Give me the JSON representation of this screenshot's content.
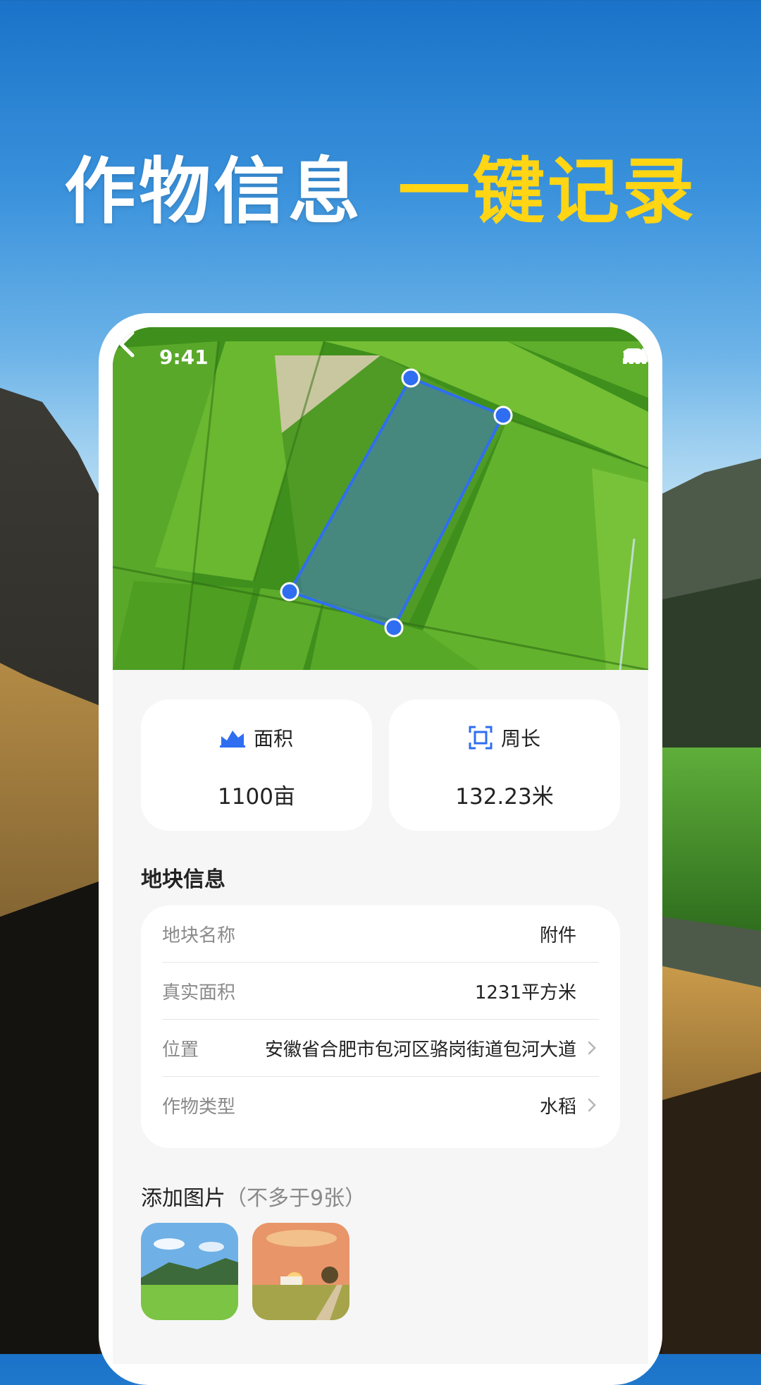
{
  "headline": {
    "part1": "作物信息",
    "part2": "一键记录"
  },
  "status_bar": {
    "time": "9:41"
  },
  "metrics": [
    {
      "label": "面积",
      "value": "1100亩",
      "icon": "area-chart-icon"
    },
    {
      "label": "周长",
      "value": "132.23米",
      "icon": "perimeter-icon"
    }
  ],
  "plot_info": {
    "title": "地块信息",
    "rows": [
      {
        "key": "地块名称",
        "value": "附件"
      },
      {
        "key": "真实面积",
        "value": "1231平方米"
      },
      {
        "key": "位置",
        "value": "安徽省合肥市包河区骆岗街道包河大道"
      },
      {
        "key": "作物类型",
        "value": "水稻"
      }
    ]
  },
  "photos": {
    "title": "添加图片",
    "hint": "（不多于9张）",
    "count": 2
  },
  "colors": {
    "accent": "#2f6ef0",
    "highlight": "#ffd514",
    "selection": "#2f6ef0"
  }
}
